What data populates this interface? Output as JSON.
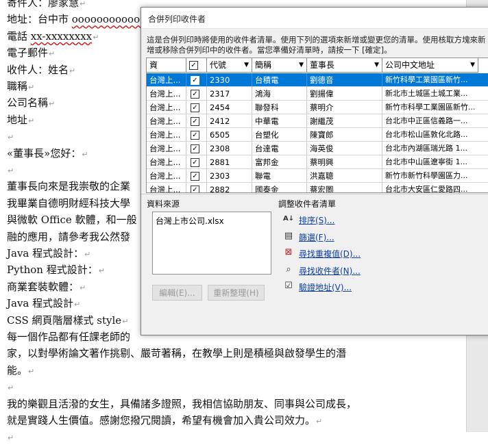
{
  "document": {
    "lines": [
      {
        "text": "寄件人：廖家慧",
        "mark": true
      },
      {
        "text": "地址：台中市 ",
        "extra": "oooooooooooo",
        "mark": true
      },
      {
        "text": "電話 ",
        "extra": "xx-xxxxxxxx",
        "mark": true
      },
      {
        "text": "電子郵件",
        "mark": true
      },
      {
        "text": "收件人：姓名",
        "mark": true
      },
      {
        "text": "職稱",
        "mark": true
      },
      {
        "text": "公司名稱",
        "mark": true
      },
      {
        "text": "地址",
        "mark": true
      },
      {
        "text": "",
        "mark": true
      },
      {
        "text": "«董事長»您好：",
        "mark": true
      },
      {
        "text": "",
        "mark": true
      },
      {
        "text": "董事長向來是我崇敬的企業",
        "mark": false
      },
      {
        "text": "我畢業自德明財經科技大學",
        "mark": false
      },
      {
        "text": "與微軟 Office 軟體，和一般",
        "mark": false
      },
      {
        "text": "融的應用，請參考我公然發",
        "mark": false
      },
      {
        "text": "Java 程式設計：",
        "mark": true
      },
      {
        "text": "Python 程式設計：",
        "mark": true
      },
      {
        "text": "商業套裝軟體：",
        "mark": true
      },
      {
        "text": "Java 程式設計",
        "mark": true
      },
      {
        "text": "CSS 網頁階層樣式 style",
        "mark": true
      },
      {
        "text": "每一個作品都有任課老師的",
        "mark": false
      },
      {
        "text": "家，以對學術論文著作挑剔、嚴苛著稱，在教學上則是積極與啟發學生的潛",
        "mark": false
      },
      {
        "text": "能。",
        "mark": true
      },
      {
        "text": "",
        "mark": true
      },
      {
        "text": "我的樂觀且活潑的女生，具備諸多證照，我相信協助朋友、同事與公司成長，",
        "mark": false
      },
      {
        "text": "就是實踐人生價值。感謝您撥冗閱讀，希望有機會加入貴公司效力。",
        "mark": true
      },
      {
        "text": "",
        "mark": true
      }
    ]
  },
  "dialog": {
    "title": "合併列印收件者",
    "description": "這是合併列印時將使用的收件者清單。使用下列的選項來新增或變更您的清單。使用核取方塊來新增或移除合併列印中的收件者。當您準備好清單時，請按一下 [確定]。",
    "columns": [
      "資",
      "",
      "代號",
      "簡稱",
      "董事長",
      "公司中文地址"
    ],
    "rows": [
      {
        "src": "台灣上...",
        "checked": true,
        "code": "2330",
        "short": "台積電",
        "chair": "劉德音",
        "addr": "新竹科學工業園區新竹...",
        "selected": true
      },
      {
        "src": "台灣上...",
        "checked": true,
        "code": "2317",
        "short": "鴻海",
        "chair": "劉揚偉",
        "addr": "新北市土城區土城工業...",
        "selected": false
      },
      {
        "src": "台灣上...",
        "checked": true,
        "code": "2454",
        "short": "聯發科",
        "chair": "蔡明介",
        "addr": "新竹市科學工業園區新竹...",
        "selected": false
      },
      {
        "src": "台灣上...",
        "checked": true,
        "code": "2412",
        "short": "中華電",
        "chair": "謝繼茂",
        "addr": "台北市中正區信義路一...",
        "selected": false
      },
      {
        "src": "台灣上...",
        "checked": true,
        "code": "6505",
        "short": "台塑化",
        "chair": "陳寶郎",
        "addr": "台北市松山區敦化北路...",
        "selected": false
      },
      {
        "src": "台灣上...",
        "checked": true,
        "code": "2308",
        "short": "台達電",
        "chair": "海英俊",
        "addr": "台北市內湖區瑞光路 1...",
        "selected": false
      },
      {
        "src": "台灣上...",
        "checked": true,
        "code": "2881",
        "short": "富邦金",
        "chair": "蔡明興",
        "addr": "台北市中山區遼寧街 1...",
        "selected": false
      },
      {
        "src": "台灣上...",
        "checked": true,
        "code": "2303",
        "short": "聯電",
        "chair": "洪嘉聰",
        "addr": "新竹市新竹科學園區力...",
        "selected": false
      },
      {
        "src": "台灣上...",
        "checked": true,
        "code": "2882",
        "short": "國泰金",
        "chair": "蔡宏圖",
        "addr": "台北市大安區仁愛路四...",
        "selected": false
      }
    ],
    "datasource_label": "資料來源",
    "datasource_item": "台灣上市公司.xlsx",
    "edit_button": "編輯(E)...",
    "refresh_button": "重新整理(H)",
    "adjust_label": "調整收件者清單",
    "actions": [
      {
        "icon": "sort-icon",
        "label": "排序(S)..."
      },
      {
        "icon": "filter-icon",
        "label": "篩選(F)..."
      },
      {
        "icon": "find-duplicates-icon",
        "label": "尋找重複值(D)..."
      },
      {
        "icon": "find-recipient-icon",
        "label": "尋找收件者(N)..."
      },
      {
        "icon": "validate-address-icon",
        "label": "驗證地址(V)..."
      }
    ]
  }
}
